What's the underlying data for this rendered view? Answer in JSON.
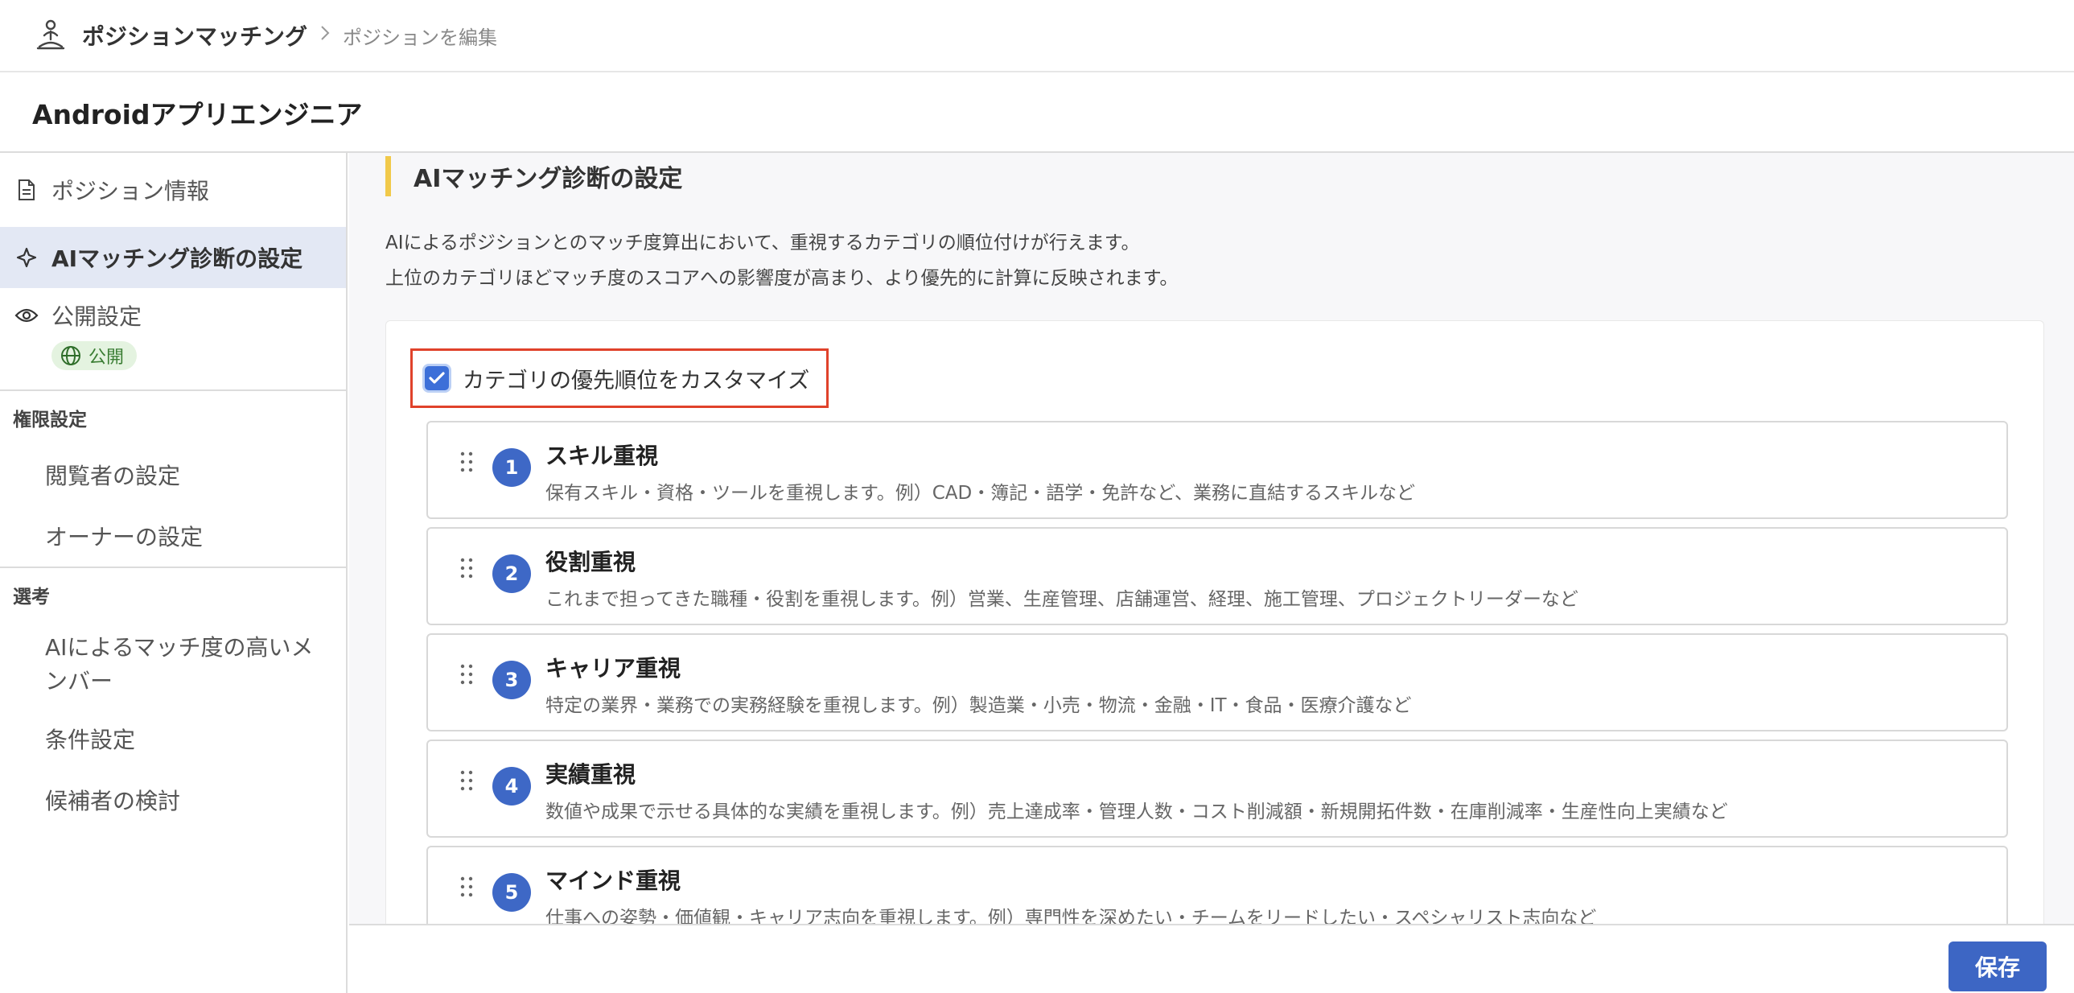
{
  "header": {
    "app_name": "ポジションマッチング",
    "breadcrumb_sep": ">",
    "breadcrumb_current": "ポジションを編集"
  },
  "page": {
    "title": "Androidアプリエンジニア"
  },
  "sidebar": {
    "position_info": "ポジション情報",
    "ai_settings": "AIマッチング診断の設定",
    "publish_settings": "公開設定",
    "publish_badge": "公開",
    "permission_section": "権限設定",
    "viewer_settings": "閲覧者の設定",
    "owner_settings": "オーナーの設定",
    "selection_section": "選考",
    "high_match_members": "AIによるマッチ度の高いメンバー",
    "condition_settings": "条件設定",
    "candidate_review": "候補者の検討"
  },
  "main": {
    "section_title": "AIマッチング診断の設定",
    "desc_line1": "AIによるポジションとのマッチ度算出において、重視するカテゴリの順位付けが行えます。",
    "desc_line2": "上位のカテゴリほどマッチ度のスコアへの影響度が高まり、より優先的に計算に反映されます。",
    "customize_checkbox_label": "カテゴリの優先順位をカスタマイズ",
    "customize_checked": true,
    "categories": [
      {
        "rank": "1",
        "title": "スキル重視",
        "desc": "保有スキル・資格・ツールを重視します。例）CAD・簿記・語学・免許など、業務に直結するスキルなど"
      },
      {
        "rank": "2",
        "title": "役割重視",
        "desc": "これまで担ってきた職種・役割を重視します。例）営業、生産管理、店舗運営、経理、施工管理、プロジェクトリーダーなど"
      },
      {
        "rank": "3",
        "title": "キャリア重視",
        "desc": "特定の業界・業務での実務経験を重視します。例）製造業・小売・物流・金融・IT・食品・医療介護など"
      },
      {
        "rank": "4",
        "title": "実績重視",
        "desc": "数値や成果で示せる具体的な実績を重視します。例）売上達成率・管理人数・コスト削減額・新規開拓件数・在庫削減率・生産性向上実績など"
      },
      {
        "rank": "5",
        "title": "マインド重視",
        "desc": "仕事への姿勢・価値観・キャリア志向を重視します。例）専門性を深めたい・チームをリードしたい・スペシャリスト志向など"
      }
    ]
  },
  "footer": {
    "save_label": "保存"
  },
  "colors": {
    "accent": "#3d66c4",
    "active_bg": "#e3e8f4",
    "highlight_border": "#e0422b",
    "section_marker": "#f1c94a",
    "badge_bg": "#e4f3e0",
    "badge_text": "#3a7d33"
  }
}
